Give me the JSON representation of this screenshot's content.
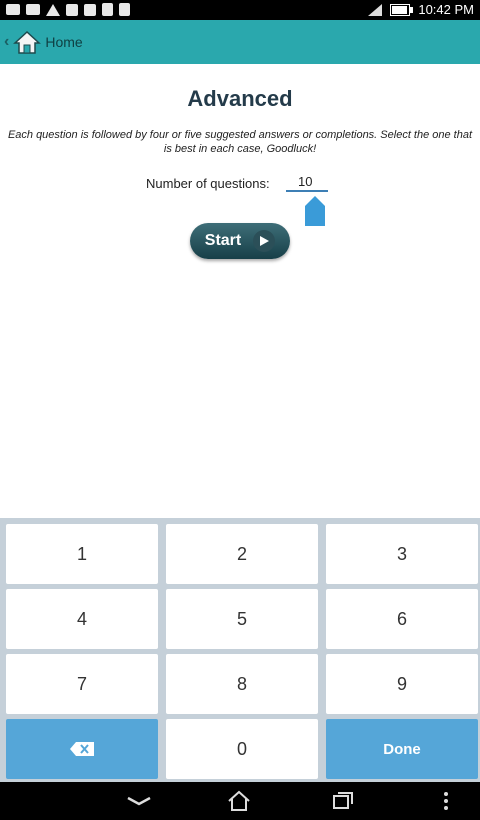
{
  "status_bar": {
    "time": "10:42 PM"
  },
  "action_bar": {
    "home_label": "Home"
  },
  "page": {
    "title": "Advanced",
    "description": "Each question is followed by four or five suggested answers or completions. Select the one that is best in each case, Goodluck!",
    "number_label": "Number of questions:",
    "number_value": "10",
    "start_label": "Start"
  },
  "keyboard": {
    "keys": [
      "1",
      "2",
      "3",
      "4",
      "5",
      "6",
      "7",
      "8",
      "9",
      "0"
    ],
    "done_label": "Done"
  },
  "colors": {
    "action_bar": "#2aa8ad",
    "key_blue": "#55a6d8",
    "title": "#243b4a"
  }
}
